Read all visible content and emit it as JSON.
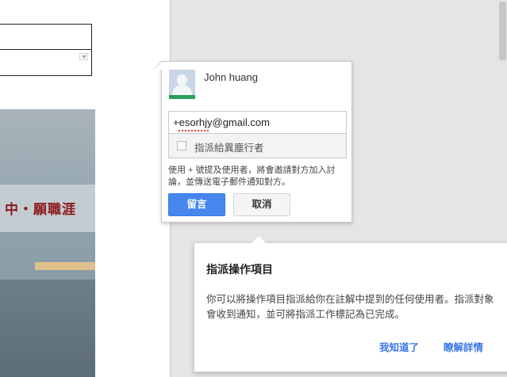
{
  "comment_popup": {
    "user_name": "John huang",
    "email_value": "+esorhjy@gmail.com",
    "assign_label": "指派給異塵行者",
    "hint_text": "使用 + 號提及使用者，將會邀請對方加入討論，並傳送電子郵件通知對方。",
    "comment_button": "留言",
    "cancel_button": "取消"
  },
  "info_card": {
    "title": "指派操作項目",
    "body": "你可以將操作項目指派給你在註解中提到的任何使用者。指派對象會收到通知，並可將指派工作標記為已完成。",
    "got_it_link": "我知道了",
    "learn_more_link": "瞭解詳情"
  },
  "document": {
    "photo_sign_text": "中・願職涯"
  },
  "colors": {
    "primary_button": "#4787ed",
    "link": "#3b78e7",
    "avatar_bar": "#29a05a"
  },
  "icons": {
    "avatar": "default-user-avatar-icon",
    "dropdown": "chevron-down-icon"
  }
}
